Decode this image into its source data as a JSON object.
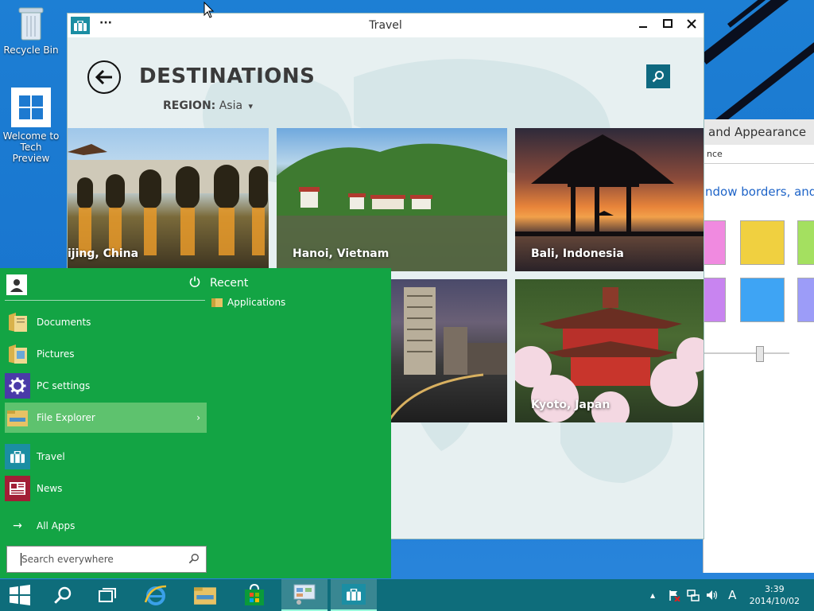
{
  "desktop": {
    "icons": [
      {
        "label": "Recycle Bin",
        "icon": "recycle-bin-icon"
      },
      {
        "label": "Welcome to Tech Preview",
        "icon": "windows-logo-icon"
      }
    ]
  },
  "control_panel": {
    "title_fragment": "and Appearance",
    "address_fragment": "nce",
    "heading_fragment": "ndow borders, and St",
    "swatches": [
      "#f08ae0",
      "#f0d040",
      "#a4e060",
      "#c884f0",
      "#3ea4f4",
      "#9c9cf8"
    ]
  },
  "travel": {
    "window_title": "Travel",
    "menu_dots": "···",
    "page_title": "DESTINATIONS",
    "region_label": "REGION:",
    "region_value": "Asia",
    "region_caret": "▾",
    "tiles": [
      {
        "label": "ijing, China"
      },
      {
        "label": "Hanoi, Vietnam"
      },
      {
        "label": "Bali, Indonesia"
      },
      {
        "label": ""
      },
      {
        "label": "Kyoto, Japan"
      }
    ]
  },
  "start_menu": {
    "recent_label": "Recent",
    "recent_items": [
      "Applications"
    ],
    "items": [
      {
        "label": "Documents",
        "icon": "documents-folder-icon"
      },
      {
        "label": "Pictures",
        "icon": "pictures-folder-icon"
      },
      {
        "label": "PC settings",
        "icon": "gear-icon"
      },
      {
        "label": "File Explorer",
        "icon": "file-explorer-icon"
      },
      {
        "label": "Travel",
        "icon": "travel-icon"
      },
      {
        "label": "News",
        "icon": "news-icon"
      }
    ],
    "file_explorer_chevron": "›",
    "all_apps_label": "All Apps",
    "all_apps_arrow": "→",
    "search_placeholder": "Search everywhere"
  },
  "taskbar": {
    "clock_time": "3:39",
    "clock_date": "2014/10/02",
    "ime_label": "A",
    "tray_up": "▲"
  },
  "colors": {
    "start_green": "#13a444",
    "taskbar_teal": "#0e6d7b",
    "travel_accent": "#0f6980"
  }
}
